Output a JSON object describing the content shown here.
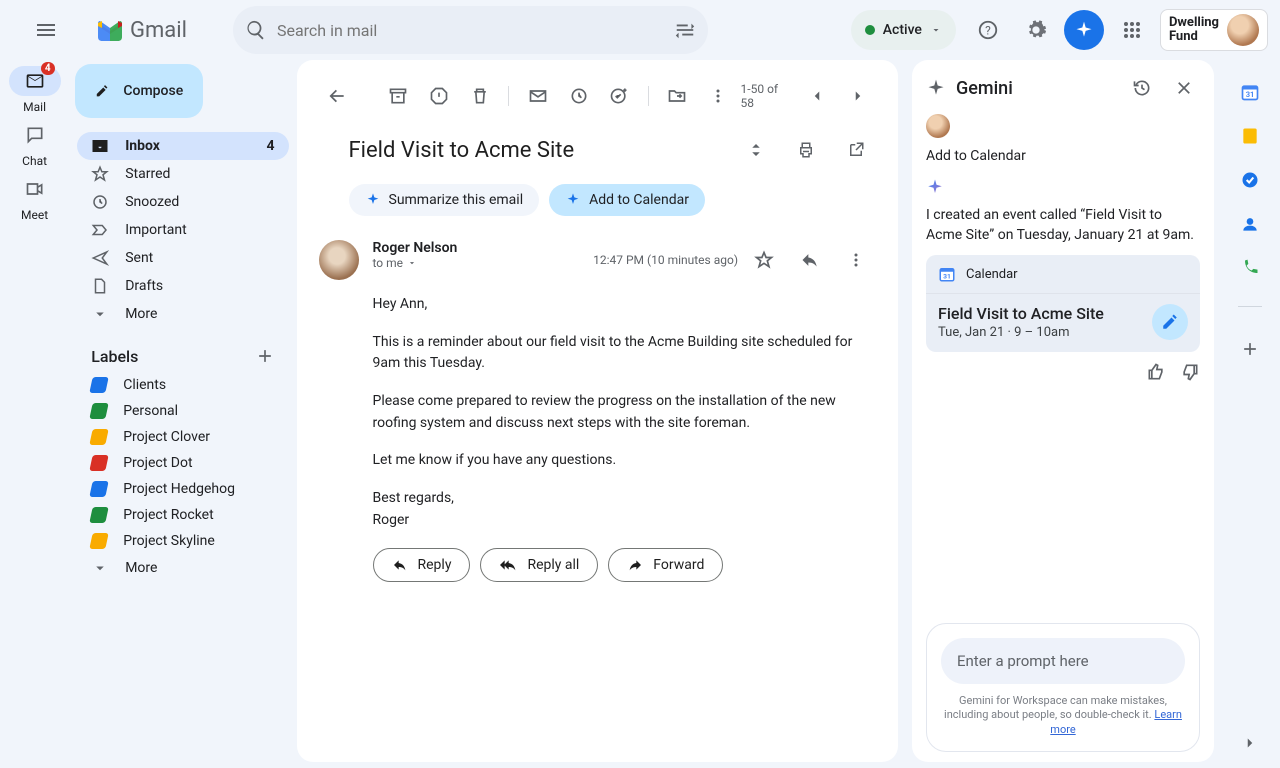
{
  "header": {
    "app_name": "Gmail",
    "search_placeholder": "Search in mail",
    "status": "Active",
    "org_name": "Dwelling\nFund"
  },
  "rail": {
    "mail": "Mail",
    "mail_badge": "4",
    "chat": "Chat",
    "meet": "Meet"
  },
  "sidebar": {
    "compose": "Compose",
    "items": [
      {
        "label": "Inbox",
        "count": "4"
      },
      {
        "label": "Starred"
      },
      {
        "label": "Snoozed"
      },
      {
        "label": "Important"
      },
      {
        "label": "Sent"
      },
      {
        "label": "Drafts"
      },
      {
        "label": "More"
      }
    ],
    "labels_header": "Labels",
    "labels": [
      {
        "label": "Clients",
        "color": "#1a73e8"
      },
      {
        "label": "Personal",
        "color": "#1e8e3e"
      },
      {
        "label": "Project Clover",
        "color": "#f9ab00"
      },
      {
        "label": "Project Dot",
        "color": "#d93025"
      },
      {
        "label": "Project Hedgehog",
        "color": "#1a73e8"
      },
      {
        "label": "Project Rocket",
        "color": "#1e8e3e"
      },
      {
        "label": "Project Skyline",
        "color": "#f9ab00"
      }
    ],
    "labels_more": "More"
  },
  "email": {
    "pager": "1-50 of 58",
    "subject": "Field Visit to Acme Site",
    "chip_summarize": "Summarize this email",
    "chip_add_cal": "Add to Calendar",
    "sender": "Roger Nelson",
    "to": "to me",
    "time": "12:47 PM (10 minutes ago)",
    "body": {
      "p1": "Hey Ann,",
      "p2": "This is a reminder about our field visit to the Acme Building site scheduled for 9am this Tuesday.",
      "p3": "Please come prepared to review the progress on the installation of the new roofing system and discuss next steps with the site foreman.",
      "p4": "Let me know if you have any questions.",
      "p5": "Best regards,",
      "p6": "Roger"
    },
    "reply": "Reply",
    "reply_all": "Reply all",
    "forward": "Forward"
  },
  "gemini": {
    "title": "Gemini",
    "action_label": "Add to Calendar",
    "response": "I created an event called “Field Visit to Acme Site” on Tuesday, January 21 at 9am.",
    "card_app": "Calendar",
    "card_title": "Field Visit to Acme Site",
    "card_time": "Tue, Jan 21 · 9 – 10am",
    "prompt_placeholder": "Enter a prompt here",
    "disclaimer_a": "Gemini for Workspace can make mistakes, including about people, so double-check it. ",
    "disclaimer_link": "Learn more"
  }
}
